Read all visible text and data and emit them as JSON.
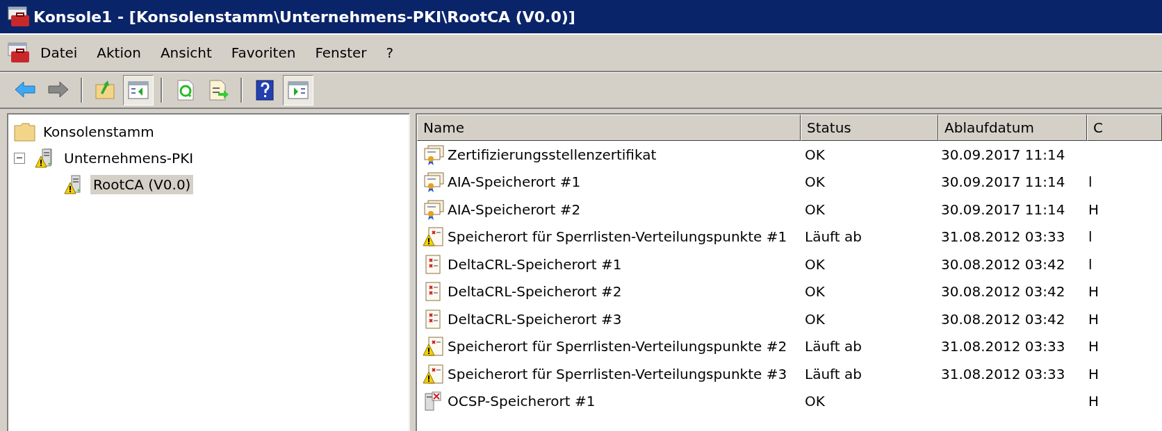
{
  "window": {
    "title": "Konsole1 - [Konsolenstamm\\Unternehmens-PKI\\RootCA (V0.0)]"
  },
  "menu": [
    "Datei",
    "Aktion",
    "Ansicht",
    "Favoriten",
    "Fenster",
    "?"
  ],
  "toolbar": [
    {
      "kind": "back",
      "pressed": false
    },
    {
      "kind": "forward",
      "pressed": false
    },
    {
      "kind": "separator"
    },
    {
      "kind": "up",
      "pressed": false
    },
    {
      "kind": "tree",
      "pressed": true
    },
    {
      "kind": "separator"
    },
    {
      "kind": "refresh",
      "pressed": false
    },
    {
      "kind": "export",
      "pressed": false
    },
    {
      "kind": "separator"
    },
    {
      "kind": "help",
      "pressed": false
    },
    {
      "kind": "actions",
      "pressed": true
    }
  ],
  "tree": [
    {
      "label": "Konsolenstamm",
      "kind": "folder",
      "selected": false,
      "children": [
        {
          "label": "Unternehmens-PKI",
          "kind": "pki",
          "expanded": true,
          "selected": false,
          "children": [
            {
              "label": "RootCA (V0.0)",
              "kind": "ca",
              "selected": true
            }
          ]
        }
      ]
    }
  ],
  "table": {
    "columns": [
      "Name",
      "Status",
      "Ablaufdatum",
      "C"
    ],
    "rows": [
      {
        "kind": "cert",
        "name": "Zertifizierungsstellenzertifikat",
        "status": "OK",
        "expires": "30.09.2017 11:14"
      },
      {
        "kind": "cert",
        "name": "AIA-Speicherort #1",
        "status": "OK",
        "expires": "30.09.2017 11:14",
        "column_4": "l"
      },
      {
        "kind": "cert",
        "name": "AIA-Speicherort #2",
        "status": "OK",
        "expires": "30.09.2017 11:14",
        "column_4": "H"
      },
      {
        "kind": "crl-warning",
        "name": "Speicherort für Sperrlisten-Verteilungspunkte #1",
        "status": "Läuft ab",
        "expires": "31.08.2012 03:33",
        "column_4": "l"
      },
      {
        "kind": "crl",
        "name": "DeltaCRL-Speicherort #1",
        "status": "OK",
        "expires": "30.08.2012 03:42",
        "column_4": "l"
      },
      {
        "kind": "crl",
        "name": "DeltaCRL-Speicherort #2",
        "status": "OK",
        "expires": "30.08.2012 03:42",
        "column_4": "H"
      },
      {
        "kind": "crl",
        "name": "DeltaCRL-Speicherort #3",
        "status": "OK",
        "expires": "30.08.2012 03:42",
        "column_4": "H"
      },
      {
        "kind": "crl-warning",
        "name": "Speicherort für Sperrlisten-Verteilungspunkte #2",
        "status": "Läuft ab",
        "expires": "31.08.2012 03:33",
        "column_4": "H"
      },
      {
        "kind": "crl-warning",
        "name": "Speicherort für Sperrlisten-Verteilungspunkte #3",
        "status": "Läuft ab",
        "expires": "31.08.2012 03:33",
        "column_4": "H"
      },
      {
        "kind": "ocsp",
        "name": "OCSP-Speicherort #1",
        "status": "OK",
        "column_4": "H"
      }
    ]
  }
}
